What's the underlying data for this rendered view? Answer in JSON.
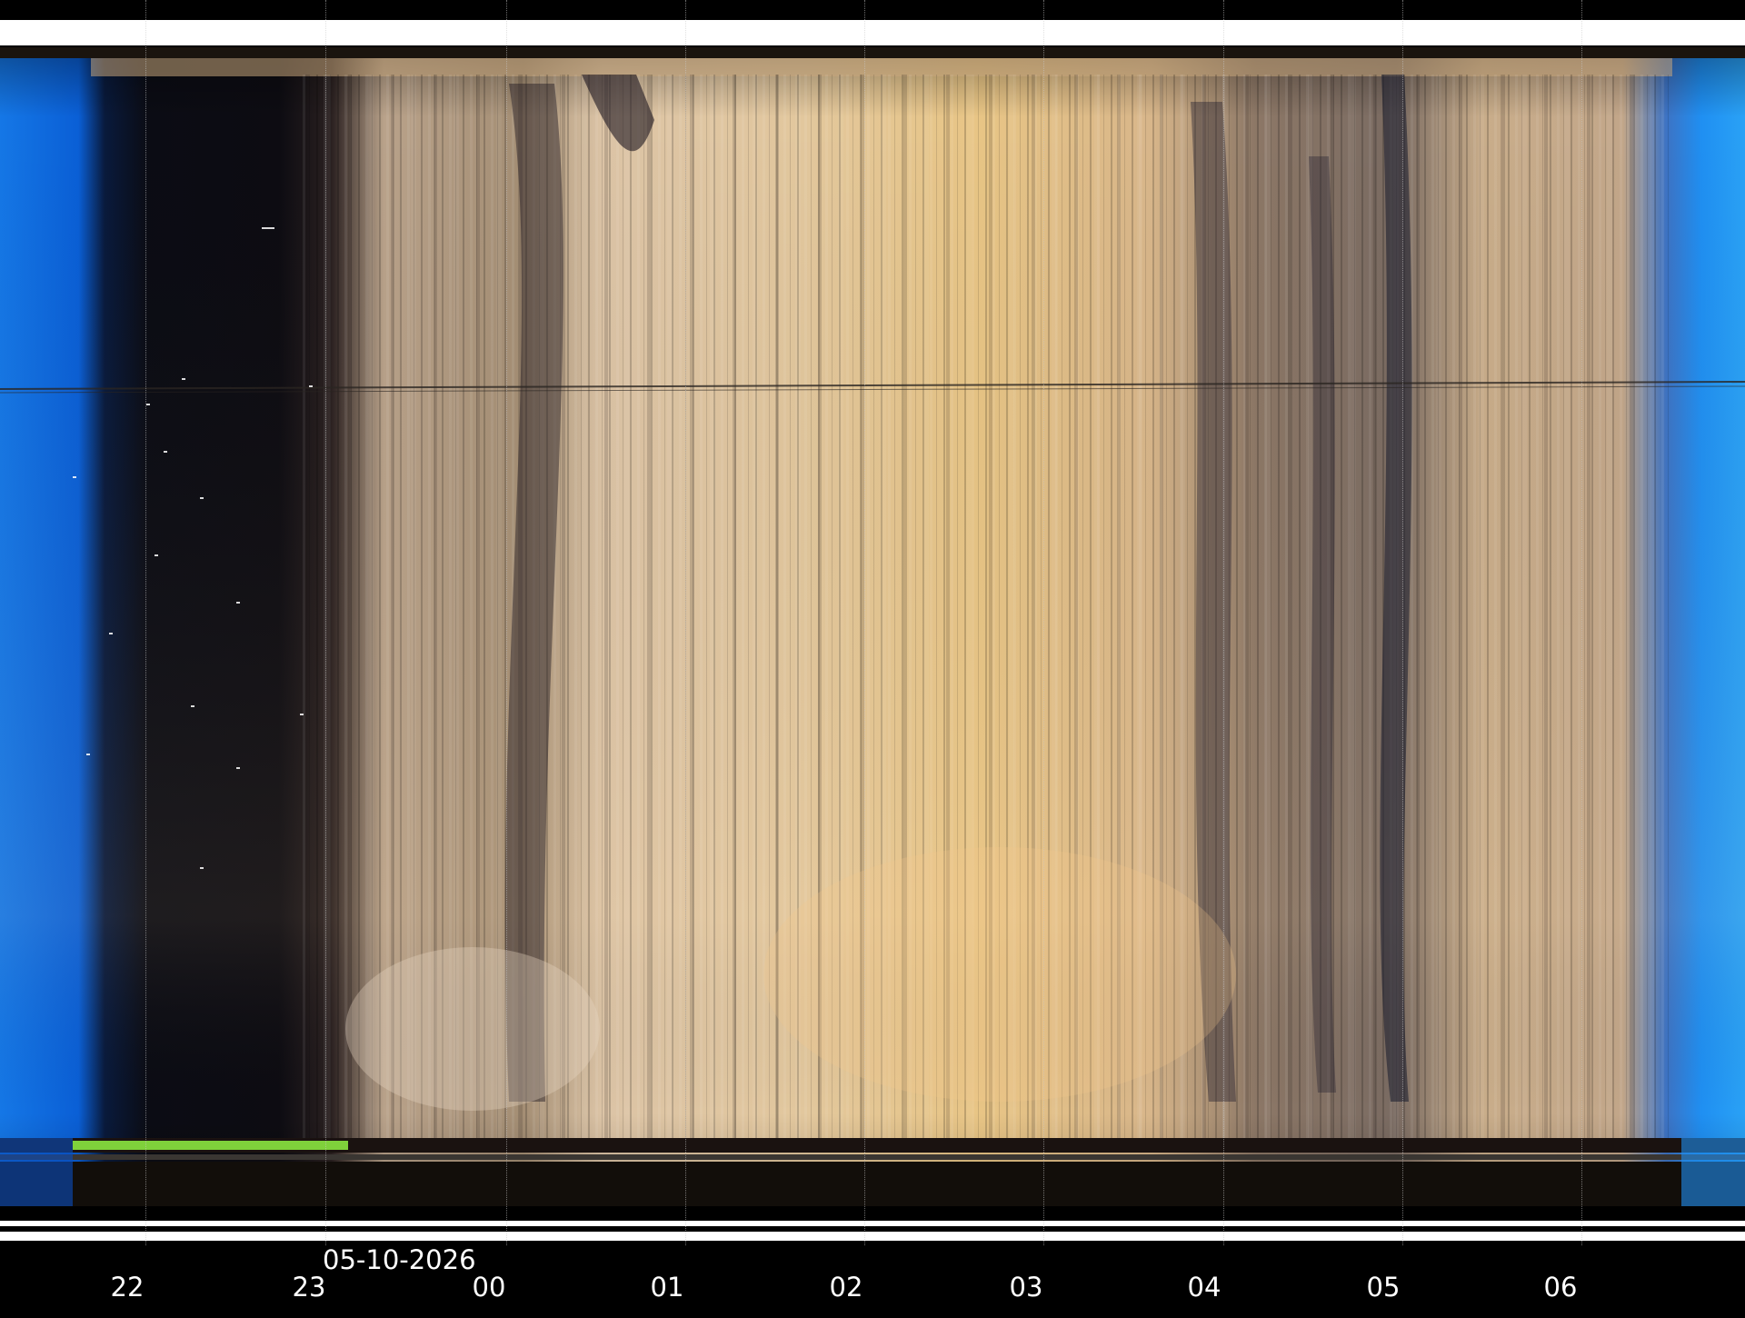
{
  "axis": {
    "date": "05-10-2026",
    "hours": [
      "22",
      "23",
      "00",
      "01",
      "02",
      "03",
      "04",
      "05",
      "06"
    ]
  },
  "image": {
    "description_free": true,
    "colors": {
      "twilight_blue": "#0a5fd6",
      "night_sky": "#0b0c14",
      "lit_cloud": "#e8c89a",
      "golden_cloud": "#d9a75a",
      "sensor_strip_green": "#7fd13b"
    }
  }
}
